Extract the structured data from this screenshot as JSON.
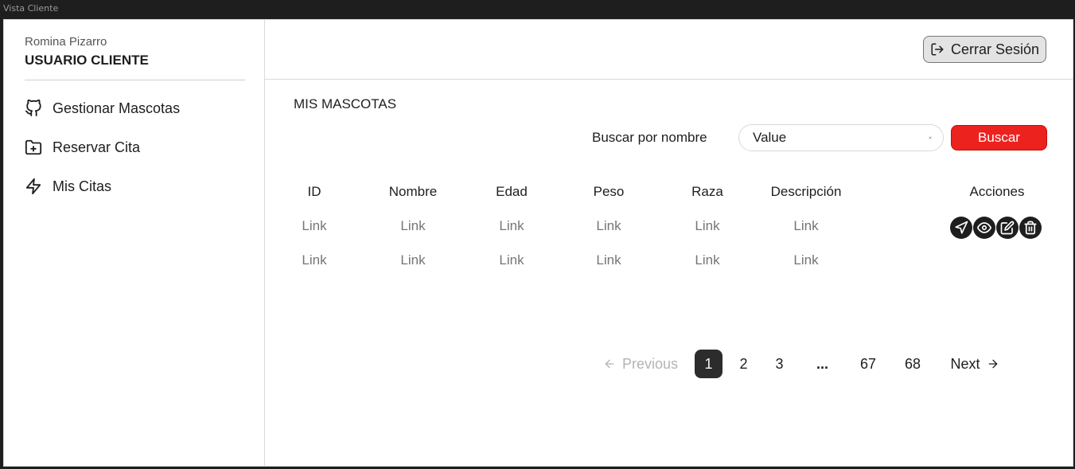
{
  "window": {
    "title": "Vista Cliente"
  },
  "sidebar": {
    "user_name": "Romina Pizarro",
    "user_role": "USUARIO CLIENTE",
    "items": [
      {
        "label": "Gestionar Mascotas",
        "icon": "github-icon"
      },
      {
        "label": "Reservar Cita",
        "icon": "folder-plus-icon"
      },
      {
        "label": "Mis Citas",
        "icon": "zap-icon"
      }
    ]
  },
  "header": {
    "logout_label": "Cerrar Sesión",
    "logout_icon": "log-out-icon"
  },
  "main": {
    "title": "MIS MASCOTAS",
    "search": {
      "label": "Buscar por nombre",
      "value": "Value",
      "button_label": "Buscar"
    },
    "table": {
      "columns": [
        "ID",
        "Nombre",
        "Edad",
        "Peso",
        "Raza",
        "Descripción",
        "Acciones"
      ],
      "rows": [
        [
          "Link",
          "Link",
          "Link",
          "Link",
          "Link",
          "Link"
        ],
        [
          "Link",
          "Link",
          "Link",
          "Link",
          "Link",
          "Link"
        ]
      ],
      "row_actions": [
        "send-icon",
        "eye-icon",
        "edit-icon",
        "trash-icon"
      ]
    },
    "pagination": {
      "previous": "Previous",
      "pages": [
        "1",
        "2",
        "3",
        "...",
        "67",
        "68"
      ],
      "current": "1",
      "next": "Next"
    }
  },
  "colors": {
    "accent": "#ec221f",
    "dark": "#1e1e1e",
    "muted": "#757575",
    "border": "#d9d9d9"
  }
}
